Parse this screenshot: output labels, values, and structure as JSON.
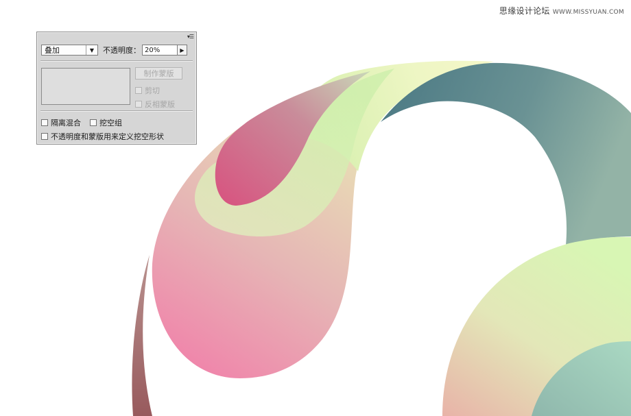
{
  "watermark": {
    "text": "思缘设计论坛",
    "site": "WWW.MISSYUAN.COM"
  },
  "panel": {
    "menu_icon": "panel-menu-icon",
    "blend_mode": "叠加",
    "opacity_label": "不透明度：",
    "opacity_value": "20%",
    "make_mask_button": "制作蒙版",
    "clip_label": "剪切",
    "invert_mask_label": "反相蒙版",
    "isolate_blending_label": "隔离混合",
    "knockout_group_label": "挖空组",
    "opacity_mask_shape_label": "不透明度和蒙版用来定义挖空形状"
  },
  "artwork": {
    "colors": {
      "pink": "#f07aa6",
      "rose": "#d65a86",
      "cream": "#f3f5c4",
      "lime": "#d8f5b0",
      "teal_dark": "#4f7c86",
      "teal_light": "#8fb3a6",
      "mint": "#a8d4c0",
      "maroon": "#9a5a5c"
    }
  }
}
